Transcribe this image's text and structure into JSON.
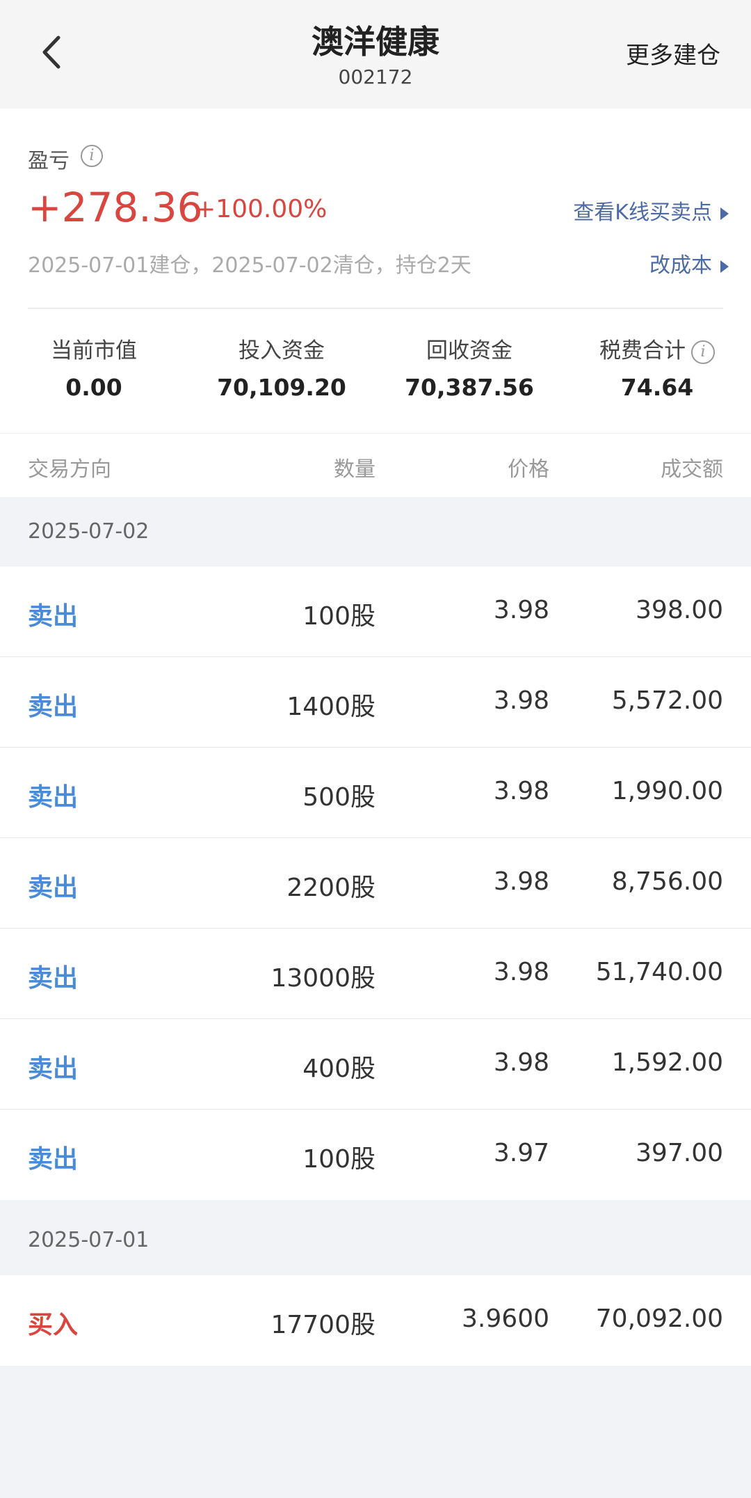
{
  "header": {
    "title": "澳洋健康",
    "code": "002172",
    "more": "更多建仓"
  },
  "summary": {
    "pl_label": "盈亏",
    "pl_value": "+278.36",
    "pl_pct": "+100.00%",
    "dates": "2025-07-01建仓，2025-07-02清仓，持仓2天",
    "kline_link": "查看K线买卖点",
    "cost_link": "改成本",
    "stats": [
      {
        "label": "当前市值",
        "value": "0.00"
      },
      {
        "label": "投入资金",
        "value": "70,109.20"
      },
      {
        "label": "回收资金",
        "value": "70,387.56"
      },
      {
        "label": "税费合计",
        "value": "74.64"
      }
    ]
  },
  "table": {
    "headers": {
      "direction": "交易方向",
      "qty": "数量",
      "price": "价格",
      "amount": "成交额"
    },
    "groups": [
      {
        "date": "2025-07-02",
        "rows": [
          {
            "dir": "卖出",
            "qty": "100股",
            "price": "3.98",
            "amount": "398.00"
          },
          {
            "dir": "卖出",
            "qty": "1400股",
            "price": "3.98",
            "amount": "5,572.00"
          },
          {
            "dir": "卖出",
            "qty": "500股",
            "price": "3.98",
            "amount": "1,990.00"
          },
          {
            "dir": "卖出",
            "qty": "2200股",
            "price": "3.98",
            "amount": "8,756.00"
          },
          {
            "dir": "卖出",
            "qty": "13000股",
            "price": "3.98",
            "amount": "51,740.00"
          },
          {
            "dir": "卖出",
            "qty": "400股",
            "price": "3.98",
            "amount": "1,592.00"
          },
          {
            "dir": "卖出",
            "qty": "100股",
            "price": "3.97",
            "amount": "397.00"
          }
        ]
      },
      {
        "date": "2025-07-01",
        "rows": [
          {
            "dir": "买入",
            "qty": "17700股",
            "price": "3.9600",
            "amount": "70,092.00"
          }
        ]
      }
    ]
  },
  "colors": {
    "profit": "#d8463f",
    "sell": "#4a8bd8",
    "link": "#4c6aa5"
  }
}
